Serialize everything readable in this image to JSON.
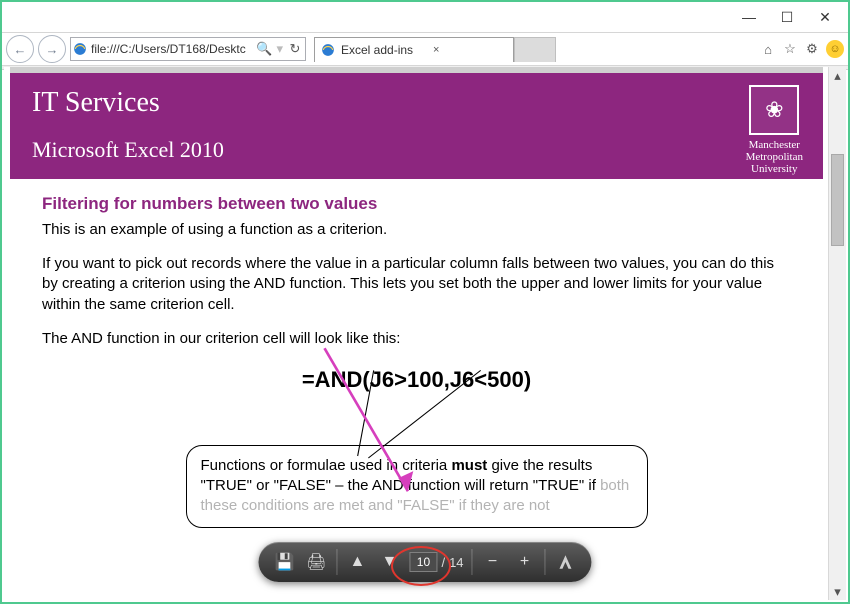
{
  "window": {
    "min": "—",
    "max": "☐",
    "close_label": "✕"
  },
  "browser": {
    "back": "←",
    "forward": "→",
    "url": "file:///C:/Users/DT168/Desktc",
    "search_icon": "🔍",
    "refresh": "↻",
    "tab_title": "Excel add-ins",
    "tab_close": "×",
    "icons": {
      "home": "⌂",
      "star": "☆",
      "gear": "⚙"
    }
  },
  "banner": {
    "title": "IT Services",
    "subtitle": "Microsoft Excel 2010",
    "uni_line1": "Manchester",
    "uni_line2": "Metropolitan",
    "uni_line3": "University",
    "badge_glyph": "❀"
  },
  "doc": {
    "heading": "Filtering for numbers between two values",
    "p1": "This is an example of using a function as a criterion.",
    "p2": "If you want to pick out records where the value in a particular column falls between two values, you can do this by creating a criterion using the AND function.  This lets you set both the upper and lower limits for your value within the same criterion cell.",
    "p3": "The AND function in our criterion cell will look like this:",
    "formula": "=AND(J6>100,J6<500)",
    "note_part1": "Functions or formulae used in criteria ",
    "note_must": "must",
    "note_part2": " give the results \"TRUE\" or \"FALSE\" – the AND function will return \"TRUE\" if ",
    "note_fade": "both these conditions are met and \"FALSE\" if they are not"
  },
  "pdf": {
    "save": "💾",
    "print": "🖨",
    "up": "▲",
    "down": "▼",
    "current_page": "10",
    "sep": "/",
    "total_pages": "14",
    "zoom_out": "−",
    "zoom_in": "+",
    "acrobat": "A"
  }
}
